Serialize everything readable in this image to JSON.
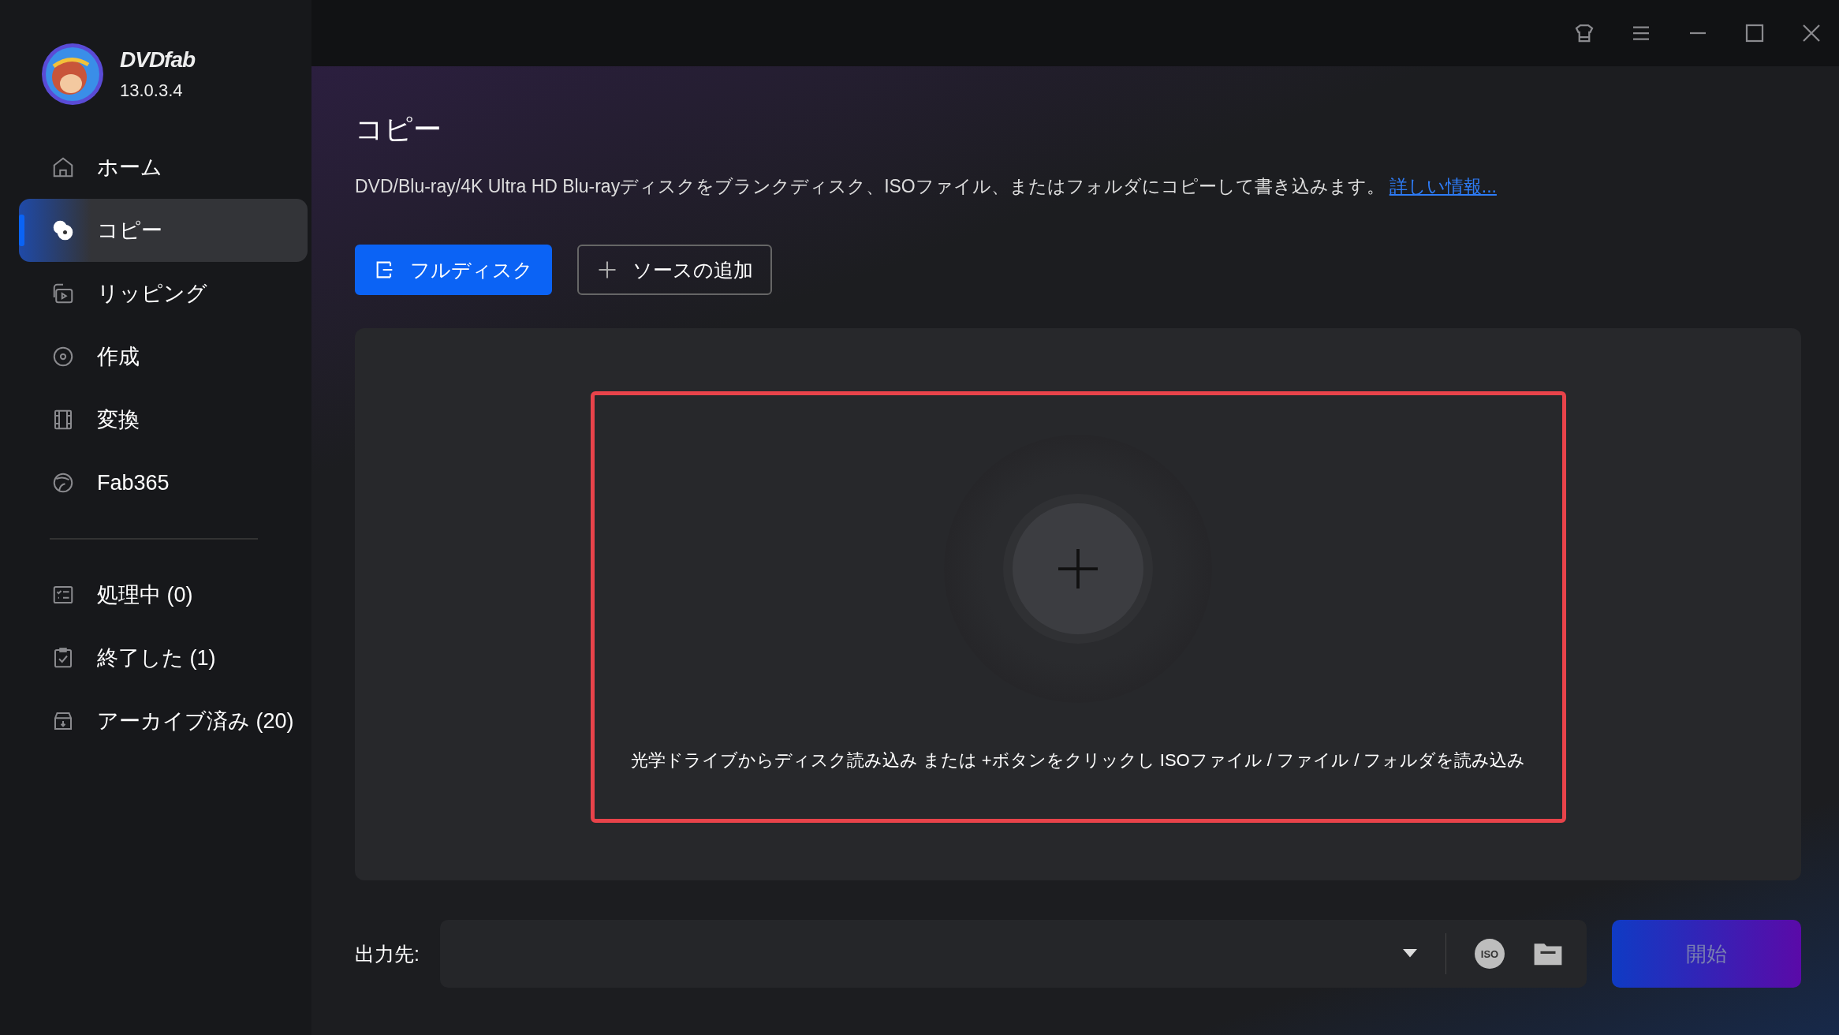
{
  "app": {
    "logo": "DVDfab",
    "version": "13.0.3.4"
  },
  "nav_items": [
    {
      "label": "ホーム",
      "selected": false
    },
    {
      "label": "コピー",
      "selected": true
    },
    {
      "label": "リッピング",
      "selected": false
    },
    {
      "label": "作成",
      "selected": false
    },
    {
      "label": "変換",
      "selected": false
    },
    {
      "label": "Fab365",
      "selected": false
    }
  ],
  "queue_items": [
    {
      "label": "処理中 (0)",
      "selected": false
    },
    {
      "label": "終了した (1)",
      "selected": false
    },
    {
      "label": "アーカイブ済み (20)",
      "selected": false
    }
  ],
  "page": {
    "title": "コピー",
    "description": "DVD/Blu-ray/4K Ultra HD Blu-rayディスクをブランクディスク、ISOファイル、またはフォルダにコピーして書き込みます。",
    "more_link": "詳しい情報..."
  },
  "mode_buttons": [
    {
      "label": "フルディスク",
      "selected": true
    },
    {
      "label": "ソースの追加",
      "selected": false
    }
  ],
  "drop_zone": {
    "hint": "光学ドライブからディスク読み込み または +ボタンをクリックし ISOファイル / ファイル / フォルダを読み込み"
  },
  "output": {
    "label": "出力先:",
    "iso_label": "ISO",
    "start_button": "開始",
    "start_disabled": true
  }
}
